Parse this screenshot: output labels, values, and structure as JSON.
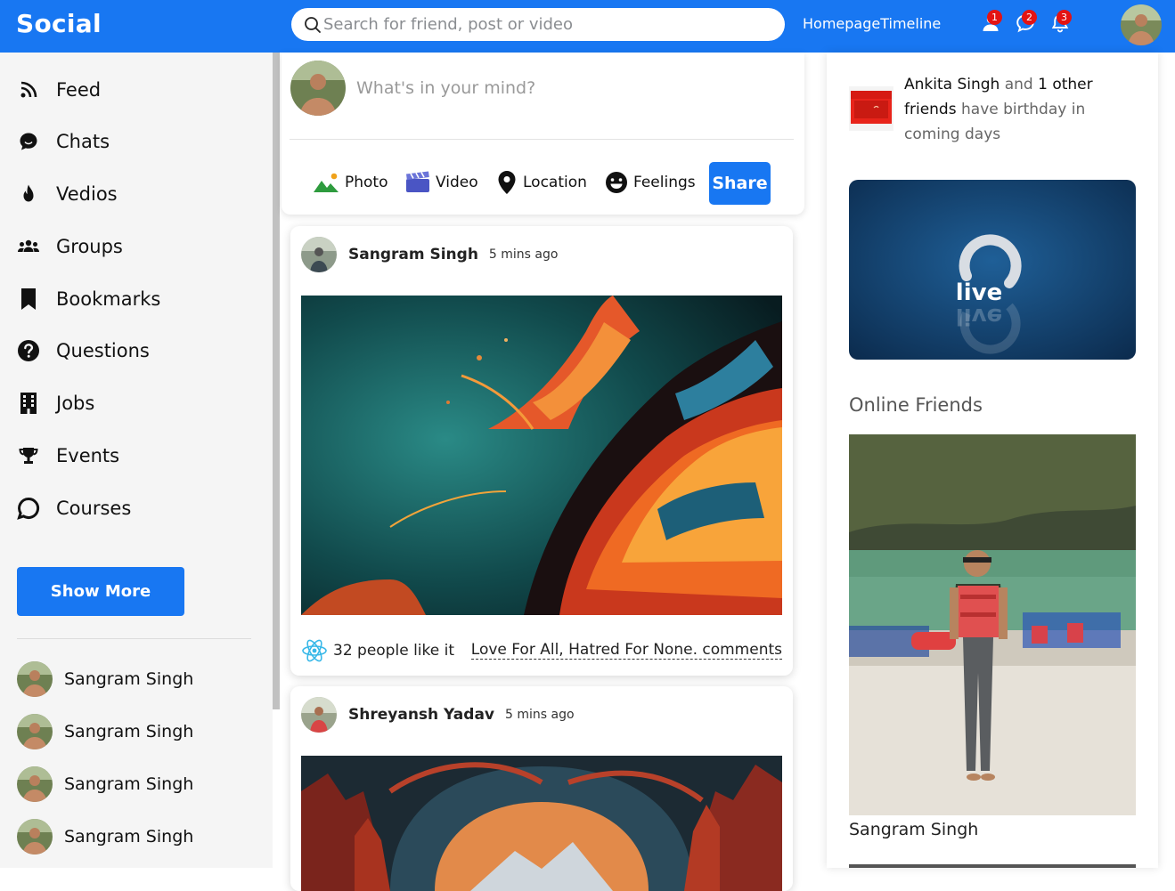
{
  "app": {
    "logo": "Social"
  },
  "topbar": {
    "search_placeholder": "Search for friend, post or video",
    "links": "HomepageTimeline",
    "notifications": [
      {
        "icon": "person-icon",
        "count": "1"
      },
      {
        "icon": "chat-bubble-icon",
        "count": "2"
      },
      {
        "icon": "bell-icon",
        "count": "3"
      }
    ]
  },
  "sidebar": {
    "items": [
      {
        "label": "Feed",
        "icon": "rss-icon"
      },
      {
        "label": "Chats",
        "icon": "chat-icon"
      },
      {
        "label": "Vedios",
        "icon": "flame-icon"
      },
      {
        "label": "Groups",
        "icon": "group-icon"
      },
      {
        "label": "Bookmarks",
        "icon": "bookmark-icon"
      },
      {
        "label": "Questions",
        "icon": "question-icon"
      },
      {
        "label": "Jobs",
        "icon": "building-icon"
      },
      {
        "label": "Events",
        "icon": "trophy-icon"
      },
      {
        "label": "Courses",
        "icon": "speech-icon"
      }
    ],
    "show_more": "Show More",
    "friends": [
      "Sangram Singh",
      "Sangram Singh",
      "Sangram Singh",
      "Sangram Singh"
    ]
  },
  "share": {
    "placeholder": "What's in your mind?",
    "options": [
      "Photo",
      "Video",
      "Location",
      "Feelings"
    ],
    "button": "Share"
  },
  "posts": [
    {
      "author": "Sangram Singh",
      "time": "5 mins ago",
      "likes": "32 people like it",
      "comments": "Love For All, Hatred For None. comments"
    },
    {
      "author": "Shreyansh Yadav",
      "time": "5 mins ago"
    }
  ],
  "rightbar": {
    "birthday": {
      "name": "Ankita Singh",
      "and": "and",
      "count": "1 other friends",
      "rest": "have birthday in coming days"
    },
    "live_label": "live",
    "online_title": "Online Friends",
    "online_friend": "Sangram Singh"
  },
  "colors": {
    "brand": "#1877f2",
    "badge": "#e31313",
    "sidebar_bg": "#f5f5f5"
  }
}
